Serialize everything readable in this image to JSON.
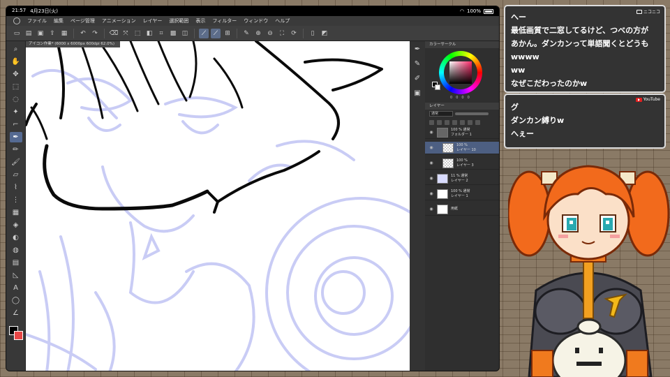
{
  "status_bar": {
    "time": "21:57",
    "date": "4月23日(火)",
    "battery": "100%"
  },
  "menu": {
    "items": [
      "ファイル",
      "編集",
      "ページ管理",
      "アニメーション",
      "レイヤー",
      "選択範囲",
      "表示",
      "フィルター",
      "ウィンドウ",
      "ヘルプ"
    ]
  },
  "document": {
    "tab_title": "アイコン作業* (6000 x 6000px 600dpi 62.0%)"
  },
  "color_panel": {
    "title": "カラーサークル",
    "values": [
      "0",
      "0",
      "0",
      "0"
    ]
  },
  "layer_panel": {
    "title": "レイヤー",
    "blend_mode": "通常",
    "layers": [
      {
        "line1": "100 %  通常",
        "line2": "フォルダー 1",
        "type": "folder",
        "selected": false,
        "indent": 0
      },
      {
        "line1": "100 %",
        "line2": "レイヤー 10",
        "type": "raster",
        "selected": true,
        "indent": 1
      },
      {
        "line1": "100 %",
        "line2": "レイヤー 3",
        "type": "raster",
        "selected": false,
        "indent": 1
      },
      {
        "line1": "11 %  通常",
        "line2": "レイヤー 2",
        "type": "sketch",
        "selected": false,
        "indent": 0
      },
      {
        "line1": "100 %  通常",
        "line2": "レイヤー 1",
        "type": "raster",
        "selected": false,
        "indent": 0
      },
      {
        "line1": "",
        "line2": "用紙",
        "type": "paper",
        "selected": false,
        "indent": 0
      }
    ]
  },
  "chat": {
    "nico_label": "ニコニコ",
    "youtube_label": "YouTube",
    "nico_messages": [
      "へー",
      "最低画質で二窓してるけど、つべの方が",
      "あかん。ダンカンって単語聞くとどうも",
      "wwww",
      "ww",
      "なぜこだわったのかw"
    ],
    "youtube_messages": [
      "グ",
      "ダンカン縛りw",
      "へぇー"
    ]
  },
  "icons": {
    "tools": [
      "zoom-icon",
      "hand-icon",
      "move-icon",
      "select-icon",
      "lasso-icon",
      "wand-icon",
      "eyedropper-icon",
      "pen-icon",
      "pencil-icon",
      "brush-icon",
      "eraser-icon",
      "marker-icon",
      "airbrush-icon",
      "decoration-icon",
      "fill-icon",
      "gradient-icon",
      "blend-icon",
      "figure-icon",
      "frame-icon",
      "text-icon",
      "balloon-icon",
      "line-edit-icon"
    ]
  }
}
